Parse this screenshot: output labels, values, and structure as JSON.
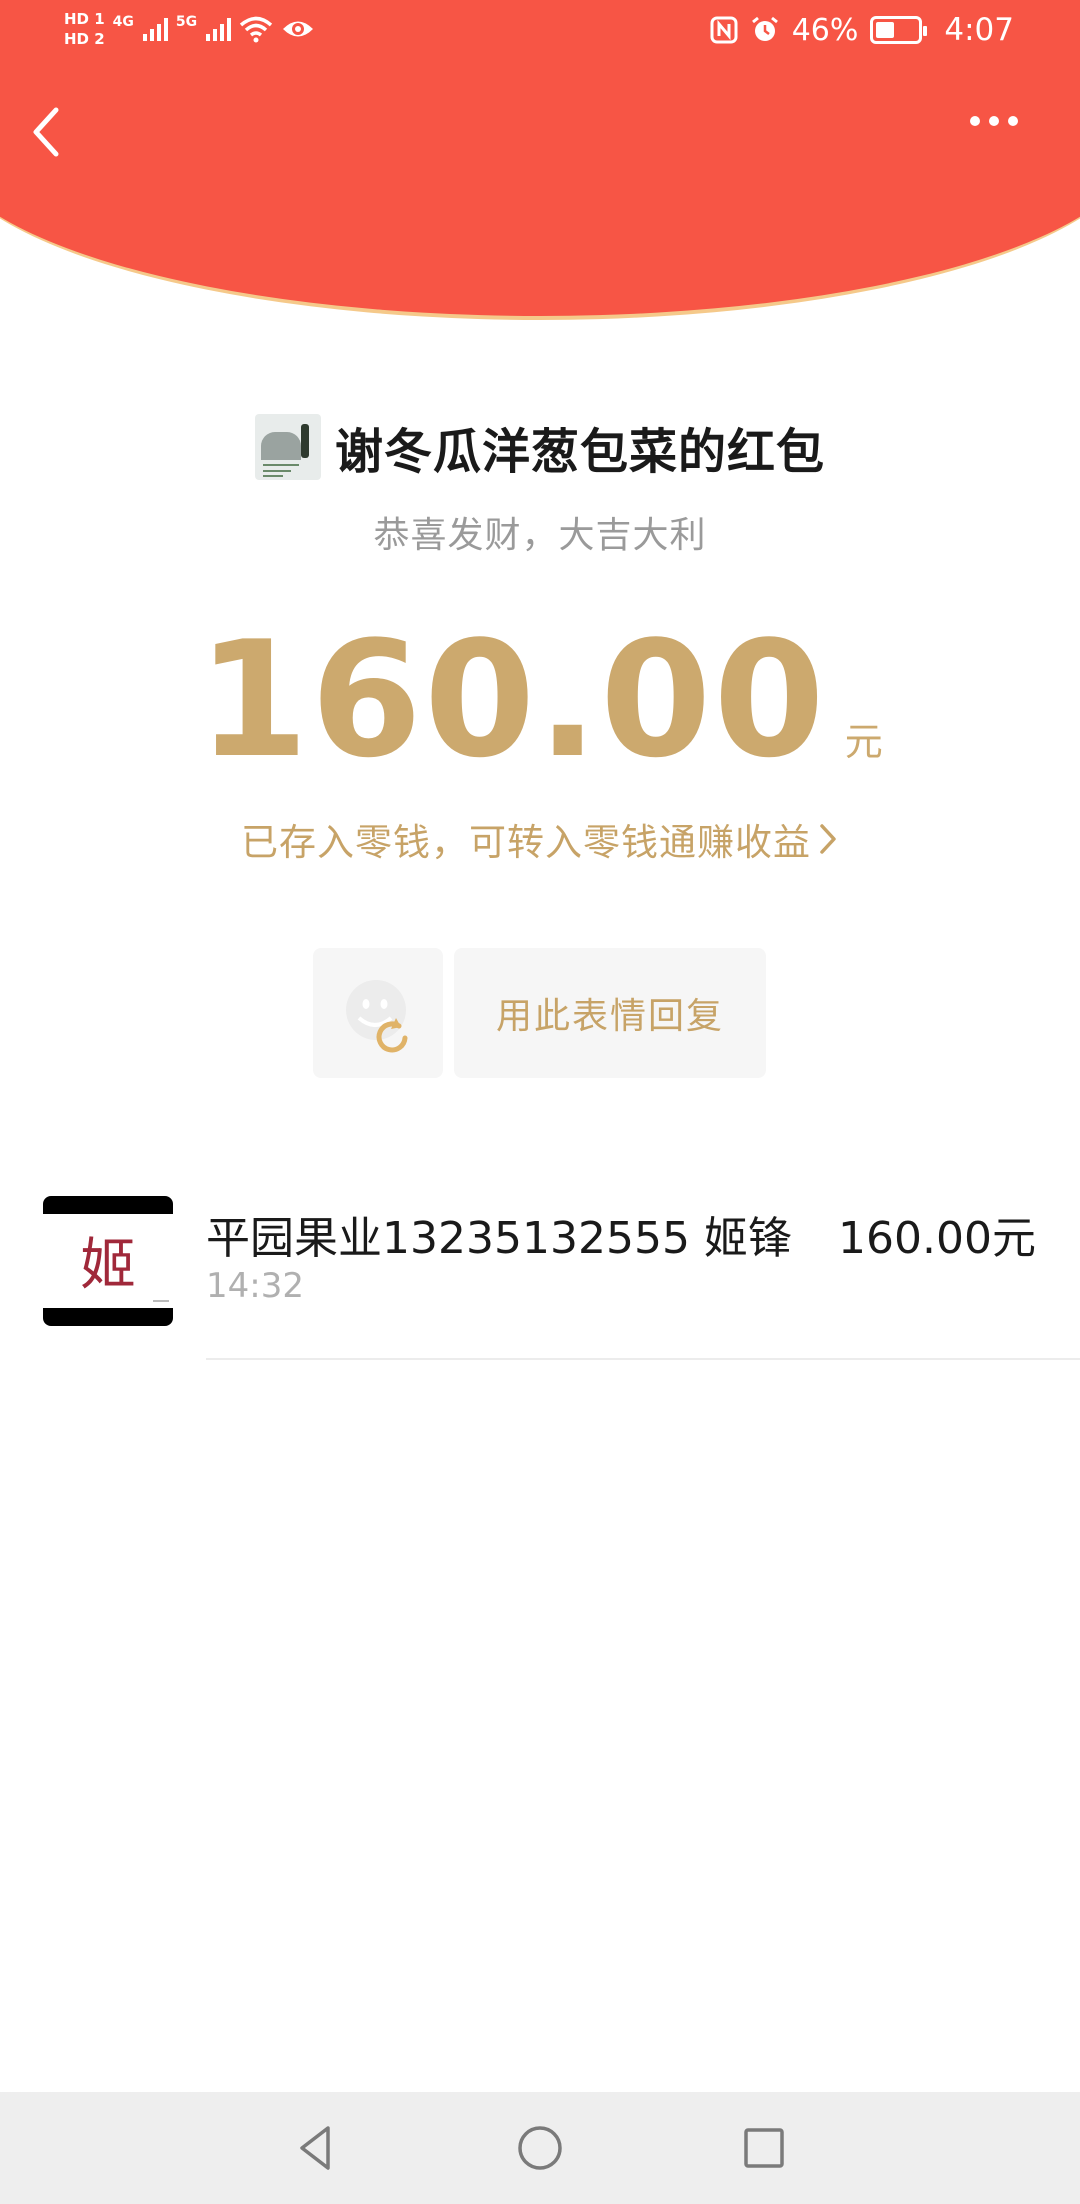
{
  "status_bar": {
    "hd1": "HD 1",
    "hd2": "HD 2",
    "net1": "4G",
    "net2": "5G",
    "nfc": "N",
    "battery_percent": "46%",
    "time": "4:07"
  },
  "nav": {
    "back_icon": "chevron-left-icon",
    "more_icon": "more-dots-icon"
  },
  "envelope": {
    "sender_title": "谢冬瓜洋葱包菜的红包",
    "wish": "恭喜发财，大吉大利",
    "amount": "160.00",
    "unit": "元",
    "saved_text": "已存入零钱，可转入零钱通赚收益"
  },
  "reply": {
    "sticker_icon": "sticker-refresh-icon",
    "label": "用此表情回复"
  },
  "receivers": [
    {
      "name": "平园果业13235132555  姬锋",
      "amount": "160.00元",
      "time": "14:32",
      "avatar_glyph": "姬"
    }
  ],
  "system_nav": {
    "back_icon": "triangle-back-icon",
    "home_icon": "circle-home-icon",
    "recents_icon": "square-recents-icon"
  },
  "colors": {
    "header_red": "#f75545",
    "gold": "#cca96e",
    "header_rim": "#f5c98a"
  }
}
